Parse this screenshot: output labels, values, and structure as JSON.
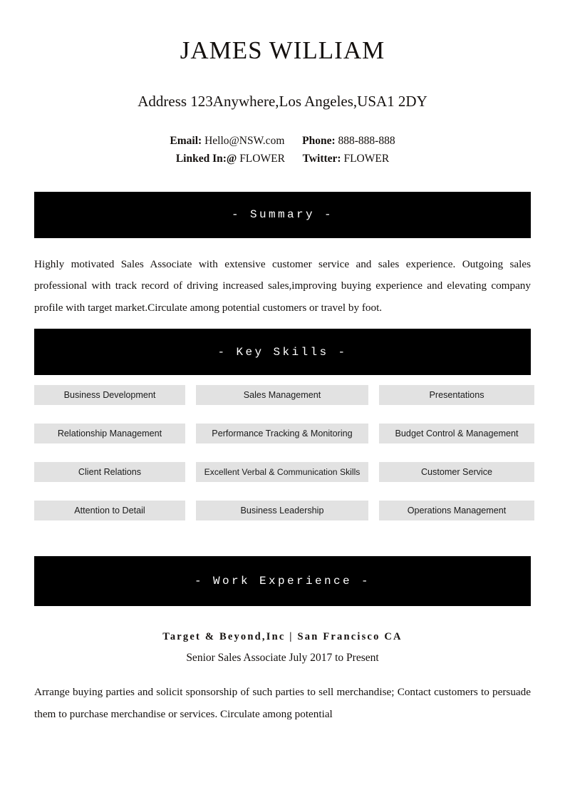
{
  "header": {
    "name": "JAMES WILLIAM",
    "address": "Address 123Anywhere,Los Angeles,USA1 2DY",
    "contact": {
      "email_label": "Email:",
      "email_value": "Hello@NSW.com",
      "phone_label": "Phone:",
      "phone_value": "888-888-888",
      "linkedin_label": "Linked In:@",
      "linkedin_value": "FLOWER",
      "twitter_label": "Twitter:",
      "twitter_value": "FLOWER"
    }
  },
  "sections": {
    "summary": {
      "banner": "- Summary -",
      "body": "Highly motivated Sales Associate with extensive customer service and sales experience. Outgoing sales professional with track record of driving increased sales,improving buying experience and elevating company profile with target market.Circulate among potential customers or travel by foot."
    },
    "key_skills": {
      "banner": "- Key Skills -",
      "items": [
        "Business Development",
        "Sales Management",
        "Presentations",
        "Relationship Management",
        "Performance Tracking & Monitoring",
        "Budget Control & Management",
        "Client Relations",
        "Excellent Verbal & Communication Skills",
        "Customer Service",
        "Attention to Detail",
        "Business Leadership",
        "Operations Management"
      ]
    },
    "work_experience": {
      "banner": "- Work Experience -",
      "jobs": [
        {
          "company_line": "Target & Beyond,Inc  |  San Francisco CA",
          "role_line": "Senior Sales Associate July 2017 to Present",
          "body": "Arrange buying parties and solicit sponsorship of such parties to sell merchandise; Contact customers to persuade them to purchase merchandise or services. Circulate among potential"
        }
      ]
    }
  },
  "colors": {
    "banner_background": "#000000",
    "banner_text": "#ffffff",
    "chip_background": "#e2e2e2",
    "body_text": "#14100e",
    "page_background": "#ffffff"
  }
}
